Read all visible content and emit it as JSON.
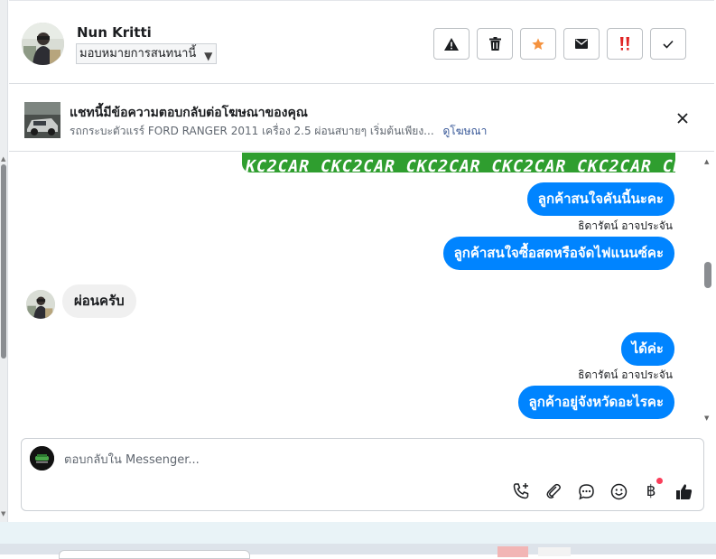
{
  "header": {
    "contact_name": "Nun Kritti",
    "assign_label": "มอบหมายการสนทนานี้",
    "actions": [
      {
        "name": "report-spam-button",
        "icon": "warning-icon"
      },
      {
        "name": "delete-button",
        "icon": "trash-icon"
      },
      {
        "name": "star-button",
        "icon": "star-icon"
      },
      {
        "name": "mark-unread-button",
        "icon": "envelope-icon"
      },
      {
        "name": "follow-up-button",
        "icon": "double-exclamation-icon"
      },
      {
        "name": "mark-done-button",
        "icon": "check-icon"
      }
    ]
  },
  "ad": {
    "title": "แชทนี้มีข้อความตอบกลับต่อโฆษณาของคุณ",
    "subtitle": "รถกระบะตัวแรร์ FORD RANGER 2011 เครื่อง 2.5 ผ่อนสบายๆ เริ่มต้นเพียง...",
    "link": "ดูโฆษณา"
  },
  "messages": {
    "banner_text": "KC2CAR CKC2CAR CKC2CAR CKC2CAR CKC2CAR CKC2",
    "out1": "ลูกค้าสนใจคันนี้นะคะ",
    "sender1": "ธิดารัตน์ อาจประจัน",
    "out2": "ลูกค้าสนใจซื้อสดหรือจัดไฟแนนซ์คะ",
    "in1": "ผ่อนครับ",
    "out3": "ได้ค่ะ",
    "sender2": "ธิดารัตน์ อาจประจัน",
    "out4": "ลูกค้าอยู่จังหวัดอะไรคะ"
  },
  "composer": {
    "placeholder": "ตอบกลับใน Messenger...",
    "tools": [
      "phone-plus-icon",
      "paperclip-icon",
      "chat-bubble-icon",
      "emoji-icon",
      "baht-icon",
      "thumbs-up-icon"
    ]
  },
  "colors": {
    "accent": "#0084ff",
    "banner_green": "#2f9e2f",
    "star": "#f5923e",
    "alert": "#e02424"
  }
}
